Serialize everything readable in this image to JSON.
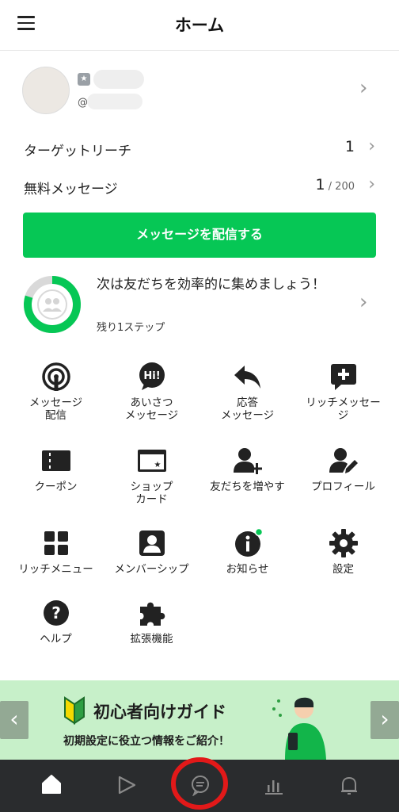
{
  "header": {
    "title": "ホーム",
    "menu_icon": "hamburger-icon"
  },
  "profile": {
    "handle_prefix": "@",
    "badge_icon": "shield-badge-icon"
  },
  "stats": [
    {
      "label": "ターゲットリーチ",
      "value": "1",
      "suffix": ""
    },
    {
      "label": "無料メッセージ",
      "value": "1",
      "suffix": " / 200"
    }
  ],
  "cta": {
    "label": "メッセージを配信する",
    "color": "#06c755"
  },
  "progress": {
    "title": "次は友だちを効率的に集めましょう！",
    "subtitle": "残り1ステップ",
    "fraction": 0.8
  },
  "menu": [
    {
      "label": "メッセージ\n配信",
      "icon": "broadcast-icon"
    },
    {
      "label": "あいさつ\nメッセージ",
      "icon": "hi-bubble-icon"
    },
    {
      "label": "応答\nメッセージ",
      "icon": "reply-icon"
    },
    {
      "label": "リッチメッセー\nジ",
      "icon": "rich-message-icon"
    },
    {
      "label": "クーポン",
      "icon": "coupon-icon"
    },
    {
      "label": "ショップ\nカード",
      "icon": "shop-card-icon"
    },
    {
      "label": "友だちを増やす",
      "icon": "add-friend-icon"
    },
    {
      "label": "プロフィール",
      "icon": "profile-edit-icon"
    },
    {
      "label": "リッチメニュー",
      "icon": "rich-menu-icon"
    },
    {
      "label": "メンバーシップ",
      "icon": "membership-icon"
    },
    {
      "label": "お知らせ",
      "icon": "info-icon"
    },
    {
      "label": "設定",
      "icon": "gear-icon"
    },
    {
      "label": "ヘルプ",
      "icon": "help-icon"
    },
    {
      "label": "拡張機能",
      "icon": "puzzle-icon"
    }
  ],
  "banner": {
    "title": "初心者向けガイド",
    "subtitle": "初期設定に役立つ情報をご紹介！",
    "bg_color": "#c7f0c9"
  },
  "tabs": [
    {
      "icon": "home-icon",
      "active": true
    },
    {
      "icon": "play-icon",
      "active": false
    },
    {
      "icon": "chat-icon",
      "active": false,
      "highlighted": true
    },
    {
      "icon": "bar-chart-icon",
      "active": false
    },
    {
      "icon": "bell-icon",
      "active": false
    }
  ]
}
